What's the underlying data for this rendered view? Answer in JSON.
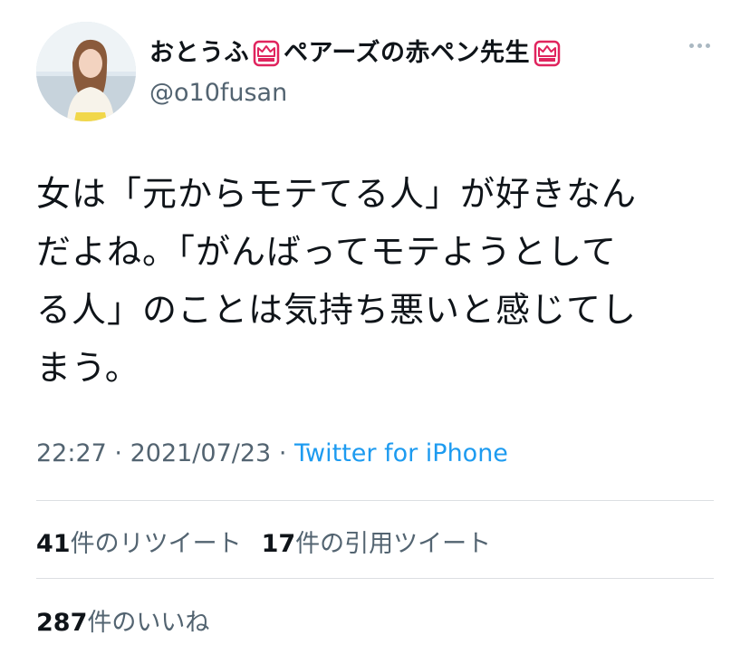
{
  "user": {
    "display_name_part1": "おとうふ",
    "display_name_part2": "ペアーズの赤ペン先生",
    "handle": "@o10fusan",
    "badge_icon": "crown-badge-icon"
  },
  "tweet": {
    "text": "女は「元からモテてる人」が好きなん\nだよね。「がんばってモテようとして\nる人」のことは気持ち悪いと感じてし\nまう。",
    "time": "22:27",
    "separator": "·",
    "date": "2021/07/23",
    "source": "Twitter for iPhone"
  },
  "stats": {
    "retweets_count": "41",
    "retweets_label": "件のリツイート",
    "quotes_count": "17",
    "quotes_label": "件の引用ツイート",
    "likes_count": "287",
    "likes_label": "件のいいね"
  },
  "colors": {
    "text": "#0f1419",
    "secondary": "#536471",
    "link": "#1d9bf0",
    "divider": "#dcdfe2",
    "badge_red": "#e0245e"
  }
}
